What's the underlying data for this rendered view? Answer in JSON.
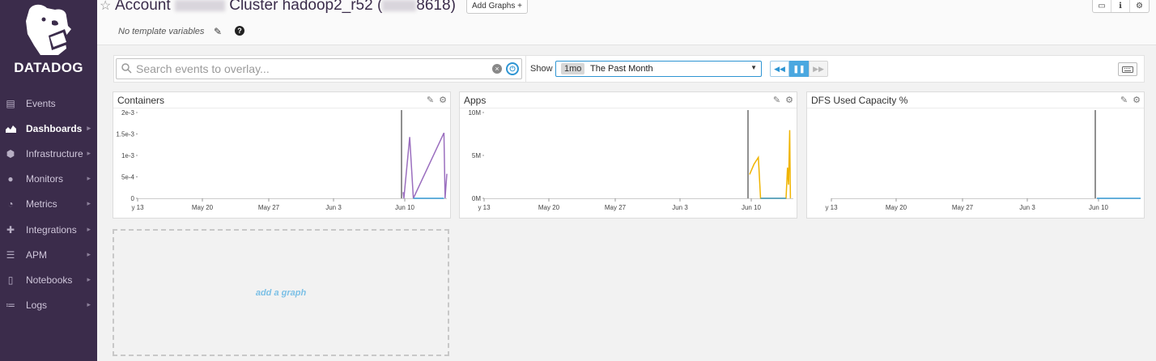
{
  "sidebar": {
    "logo_text": "DATADOG",
    "items": [
      {
        "label": "Events",
        "icon": "list-icon",
        "active": false
      },
      {
        "label": "Dashboards",
        "icon": "area-chart-icon",
        "active": true
      },
      {
        "label": "Infrastructure",
        "icon": "hexagon-nodes-icon",
        "active": false
      },
      {
        "label": "Monitors",
        "icon": "alert-icon",
        "active": false
      },
      {
        "label": "Metrics",
        "icon": "gauge-icon",
        "active": false
      },
      {
        "label": "Integrations",
        "icon": "puzzle-icon",
        "active": false
      },
      {
        "label": "APM",
        "icon": "apm-icon",
        "active": false
      },
      {
        "label": "Notebooks",
        "icon": "notebook-icon",
        "active": false
      },
      {
        "label": "Logs",
        "icon": "logs-icon",
        "active": false
      }
    ]
  },
  "header": {
    "title_prefix": "Account",
    "title_middle": "Cluster hadoop2_r52 (",
    "title_suffix": "8618)",
    "add_graphs_label": "Add Graphs +",
    "template_variables": "No template variables"
  },
  "toolbar": {
    "search_placeholder": "Search events to overlay...",
    "show_label": "Show",
    "timeframe_pill": "1mo",
    "timeframe_label": "The Past Month"
  },
  "widgets": [
    {
      "title": "Containers"
    },
    {
      "title": "Apps"
    },
    {
      "title": "DFS Used Capacity %"
    }
  ],
  "add_graph_label": "add a graph",
  "chart_data": [
    {
      "type": "line",
      "title": "Containers",
      "x_ticks": [
        "y 13",
        "May 20",
        "May 27",
        "Jun 3",
        "Jun 10"
      ],
      "y_ticks": [
        "2e-3",
        "1.5e-3",
        "1e-3",
        "5e-4",
        "0"
      ],
      "ylim": [
        0,
        0.002
      ],
      "series": [
        {
          "color": "#9b6fbf",
          "points": [
            [
              0,
              0.00015
            ],
            [
              0.1,
              0
            ],
            [
              0.9,
              0.0015
            ],
            [
              1.4,
              0
            ],
            [
              5.6,
              0.0016
            ],
            [
              5.75,
              0
            ],
            [
              6.0,
              0.0006
            ]
          ]
        },
        {
          "color": "#3a9ed8",
          "points": [
            [
              1.4,
              0
            ],
            [
              5.6,
              0
            ]
          ]
        }
      ],
      "event_marker_day": 0
    },
    {
      "type": "line",
      "title": "Apps",
      "x_ticks": [
        "y 13",
        "May 20",
        "May 27",
        "Jun 3",
        "Jun 10"
      ],
      "y_ticks": [
        "10M",
        "5M",
        "0M"
      ],
      "ylim": [
        0,
        12000000
      ],
      "series": [
        {
          "color": "#f0b400",
          "points": [
            [
              0,
              3500000
            ],
            [
              0.6,
              5000000
            ],
            [
              1.2,
              6000000
            ],
            [
              1.5,
              0
            ],
            [
              5.0,
              0
            ],
            [
              5.2,
              4500000
            ],
            [
              5.35,
              2000000
            ],
            [
              5.5,
              10000000
            ],
            [
              5.6,
              0
            ]
          ]
        },
        {
          "color": "#3a9ed8",
          "points": [
            [
              1.5,
              0
            ],
            [
              5.0,
              0
            ]
          ]
        }
      ],
      "event_marker_day": 0
    },
    {
      "type": "line",
      "title": "DFS Used Capacity %",
      "x_ticks": [
        "y 13",
        "May 20",
        "May 27",
        "Jun 3",
        "Jun 10"
      ],
      "y_ticks": [],
      "ylim": [
        0,
        1
      ],
      "series": [
        {
          "color": "#3a9ed8",
          "points": [
            [
              0,
              0
            ],
            [
              6.0,
              0
            ]
          ]
        }
      ],
      "event_marker_day": 0
    }
  ]
}
